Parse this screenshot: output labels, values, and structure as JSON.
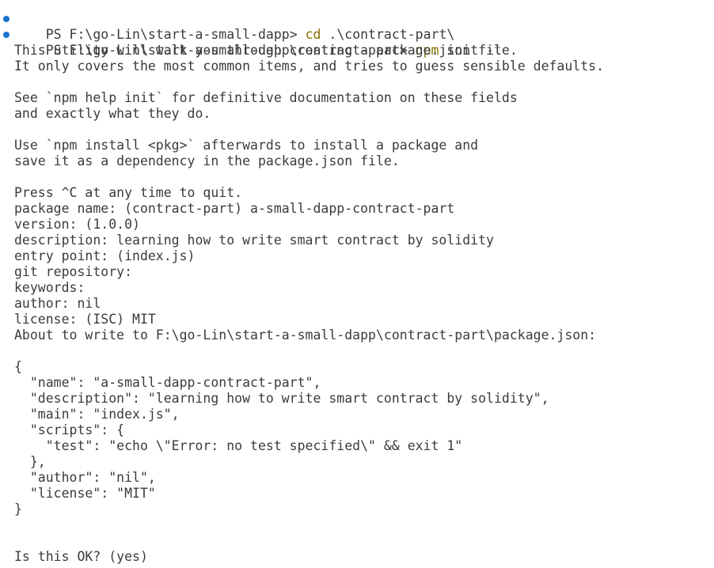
{
  "terminal": {
    "prompt1": {
      "prefix": "PS F:\\go-Lin\\start-a-small-dapp> ",
      "command": "cd",
      "args": " .\\contract-part\\"
    },
    "prompt2": {
      "prefix": "PS F:\\go-Lin\\start-a-small-dapp\\contract-part> ",
      "command": "npm",
      "args": " init ",
      "flag": "-t"
    },
    "intro": [
      "This utility will walk you through creating a package.json file.",
      "It only covers the most common items, and tries to guess sensible defaults.",
      "",
      "See `npm help init` for definitive documentation on these fields",
      "and exactly what they do.",
      "",
      "Use `npm install <pkg>` afterwards to install a package and",
      "save it as a dependency in the package.json file.",
      "",
      "Press ^C at any time to quit."
    ],
    "answers": [
      "package name: (contract-part) a-small-dapp-contract-part",
      "version: (1.0.0)",
      "description: learning how to write smart contract by solidity",
      "entry point: (index.js)",
      "git repository:",
      "keywords:",
      "author: nil",
      "license: (ISC) MIT",
      "About to write to F:\\go-Lin\\start-a-small-dapp\\contract-part\\package.json:"
    ],
    "json_preview": [
      "{",
      "  \"name\": \"a-small-dapp-contract-part\",",
      "  \"description\": \"learning how to write smart contract by solidity\",",
      "  \"main\": \"index.js\",",
      "  \"scripts\": {",
      "    \"test\": \"echo \\\"Error: no test specified\\\" && exit 1\"",
      "  },",
      "  \"author\": \"nil\",",
      "  \"license\": \"MIT\"",
      "}"
    ],
    "confirm": "Is this OK? (yes)"
  },
  "colors": {
    "background": "#ffffff",
    "text": "#3b3b3b",
    "command": "#8a7000",
    "flag": "#7f7f7f",
    "prompt_dot": "#1d74c9"
  }
}
